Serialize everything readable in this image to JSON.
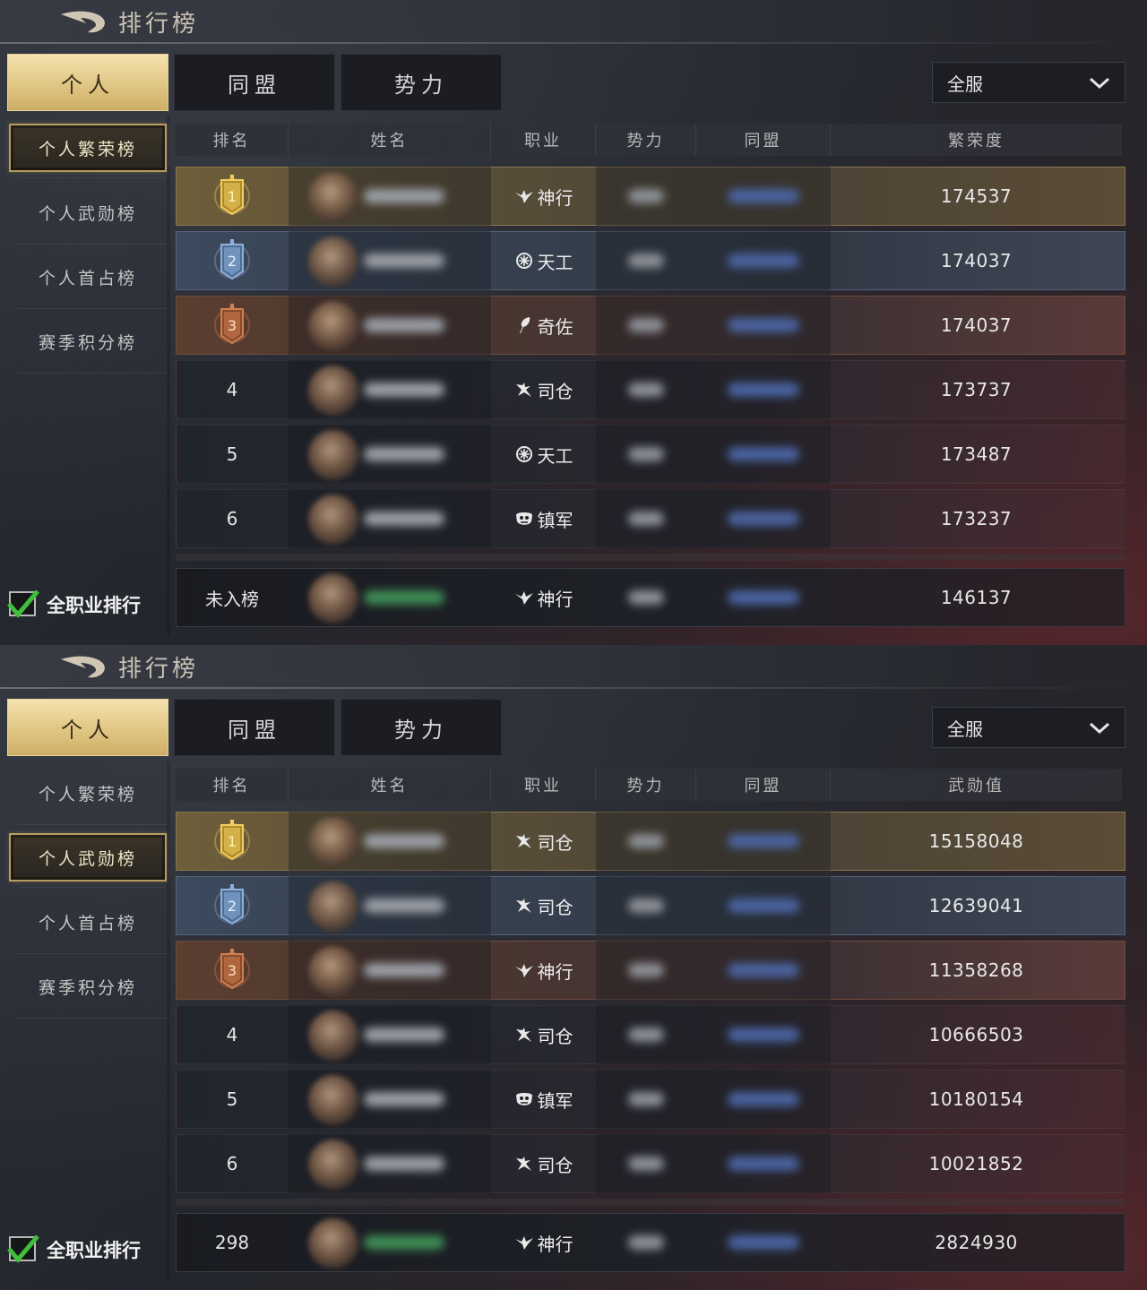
{
  "panels": [
    {
      "title": "排行榜",
      "tabs": [
        "个人",
        "同盟",
        "势力"
      ],
      "active_tab": 0,
      "server_select": "全服",
      "side_menu": [
        "个人繁荣榜",
        "个人武勋榜",
        "个人首占榜",
        "赛季积分榜"
      ],
      "active_side": 0,
      "columns": [
        "排名",
        "姓名",
        "职业",
        "势力",
        "同盟",
        "繁荣度"
      ],
      "checkbox_label": "全职业排行",
      "checkbox_checked": true,
      "rows": [
        {
          "rank": "1",
          "badge": "gold",
          "job": "神行",
          "job_icon": "bird-icon",
          "value": "174537"
        },
        {
          "rank": "2",
          "badge": "silver",
          "job": "天工",
          "job_icon": "gear-emblem-icon",
          "value": "174037"
        },
        {
          "rank": "3",
          "badge": "bronze",
          "job": "奇佐",
          "job_icon": "feather-icon",
          "value": "174037"
        },
        {
          "rank": "4",
          "badge": "",
          "job": "司仓",
          "job_icon": "dragon-icon",
          "value": "173737"
        },
        {
          "rank": "5",
          "badge": "",
          "job": "天工",
          "job_icon": "gear-emblem-icon",
          "value": "173487"
        },
        {
          "rank": "6",
          "badge": "",
          "job": "镇军",
          "job_icon": "mask-icon",
          "value": "173237"
        }
      ],
      "self_row": {
        "rank": "未入榜",
        "job": "神行",
        "job_icon": "bird-icon",
        "value": "146137"
      }
    },
    {
      "title": "排行榜",
      "tabs": [
        "个人",
        "同盟",
        "势力"
      ],
      "active_tab": 0,
      "server_select": "全服",
      "side_menu": [
        "个人繁荣榜",
        "个人武勋榜",
        "个人首占榜",
        "赛季积分榜"
      ],
      "active_side": 1,
      "columns": [
        "排名",
        "姓名",
        "职业",
        "势力",
        "同盟",
        "武勋值"
      ],
      "checkbox_label": "全职业排行",
      "checkbox_checked": true,
      "rows": [
        {
          "rank": "1",
          "badge": "gold",
          "job": "司仓",
          "job_icon": "dragon-icon",
          "value": "15158048"
        },
        {
          "rank": "2",
          "badge": "silver",
          "job": "司仓",
          "job_icon": "dragon-icon",
          "value": "12639041"
        },
        {
          "rank": "3",
          "badge": "bronze",
          "job": "神行",
          "job_icon": "bird-icon",
          "value": "11358268"
        },
        {
          "rank": "4",
          "badge": "",
          "job": "司仓",
          "job_icon": "dragon-icon",
          "value": "10666503"
        },
        {
          "rank": "5",
          "badge": "",
          "job": "镇军",
          "job_icon": "mask-icon",
          "value": "10180154"
        },
        {
          "rank": "6",
          "badge": "",
          "job": "司仓",
          "job_icon": "dragon-icon",
          "value": "10021852"
        }
      ],
      "self_row": {
        "rank": "298",
        "job": "神行",
        "job_icon": "bird-icon",
        "value": "2824930"
      }
    }
  ],
  "colors": {
    "gold_tab": "#e0c684",
    "gold_row": "#6e5e3a",
    "silver_row": "#3c4a5e",
    "bronze_row": "#5a3e30",
    "check_green": "#3fbf3a"
  }
}
